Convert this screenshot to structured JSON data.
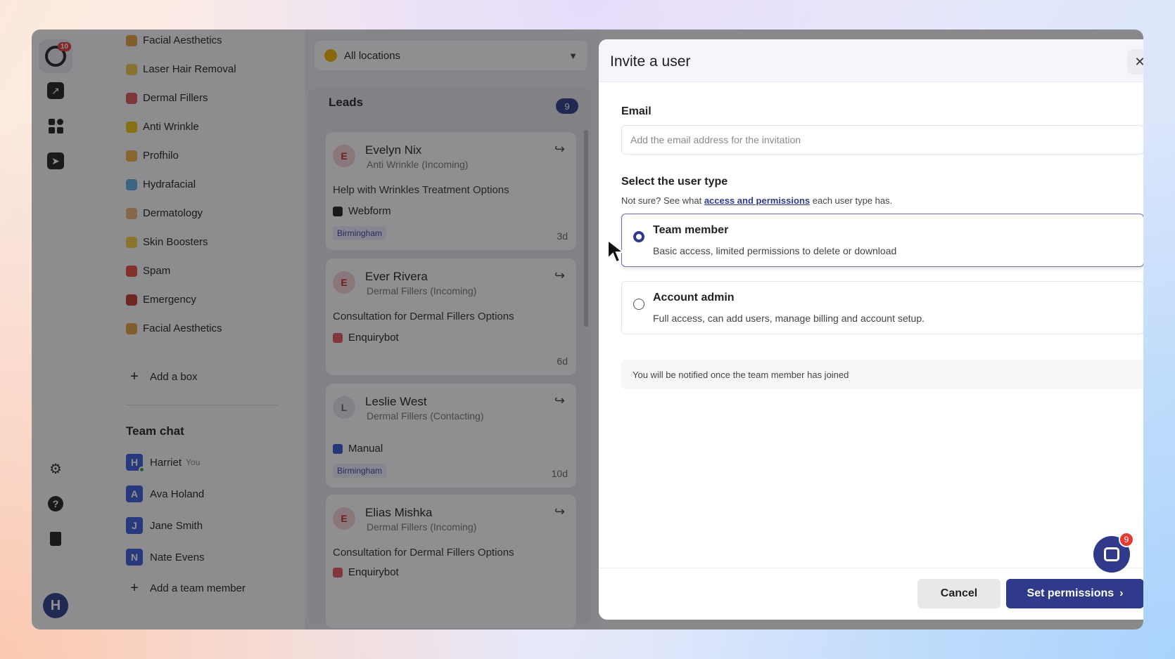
{
  "rail": {
    "logo_badge": "10",
    "user_initial": "H"
  },
  "sidebar": {
    "boxes": [
      {
        "label": "Facial Aesthetics",
        "color": "#e8a13a"
      },
      {
        "label": "Laser Hair Removal",
        "color": "#f2c94c"
      },
      {
        "label": "Dermal Fillers",
        "color": "#e0575b"
      },
      {
        "label": "Anti Wrinkle",
        "color": "#f1c40f"
      },
      {
        "label": "Profhilo",
        "color": "#f5b041"
      },
      {
        "label": "Hydrafacial",
        "color": "#5dade2"
      },
      {
        "label": "Dermatology",
        "color": "#f0b27a"
      },
      {
        "label": "Skin Boosters",
        "color": "#f4d03f"
      },
      {
        "label": "Spam",
        "color": "#e74c3c"
      },
      {
        "label": "Emergency",
        "color": "#c0392b"
      },
      {
        "label": "Facial Aesthetics",
        "color": "#e8a13a"
      }
    ],
    "add_box": "Add a box",
    "team_chat_title": "Team chat",
    "members": [
      {
        "initial": "H",
        "name": "Harriet",
        "tag": "You"
      },
      {
        "initial": "A",
        "name": "Ava Holand",
        "tag": ""
      },
      {
        "initial": "J",
        "name": "Jane Smith",
        "tag": ""
      },
      {
        "initial": "N",
        "name": "Nate Evens",
        "tag": ""
      }
    ],
    "add_member": "Add a team member"
  },
  "leads": {
    "location_filter": "All locations",
    "title": "Leads",
    "count": "9",
    "cards": [
      {
        "initial": "E",
        "name": "Evelyn Nix",
        "sub": "Anti Wrinkle (Incoming)",
        "title": "Help with Wrinkles Treatment Options",
        "source": "Webform",
        "location": "Birmingham",
        "age": "3d"
      },
      {
        "initial": "E",
        "name": "Ever Rivera",
        "sub": "Dermal Fillers (Incoming)",
        "title": "Consultation for Dermal Fillers Options",
        "source": "Enquirybot",
        "location": "",
        "age": "6d"
      },
      {
        "initial": "L",
        "name": "Leslie West",
        "sub": "Dermal Fillers (Contacting)",
        "title": "",
        "source": "Manual",
        "location": "Birmingham",
        "age": "10d"
      },
      {
        "initial": "E",
        "name": "Elias Mishka",
        "sub": "Dermal Fillers (Incoming)",
        "title": "Consultation for Dermal Fillers Options",
        "source": "Enquirybot",
        "location": "",
        "age": ""
      }
    ]
  },
  "modal": {
    "title": "Invite a user",
    "email_label": "Email",
    "email_placeholder": "Add the email address for the invitation",
    "user_type_label": "Select the user type",
    "hint_prefix": "Not sure? See what",
    "hint_link": "access and permissions",
    "hint_suffix": "each user type has.",
    "options": [
      {
        "title": "Team member",
        "desc": "Basic access, limited permissions to delete or download",
        "selected": true
      },
      {
        "title": "Account admin",
        "desc": "Full access, can add users, manage billing and account setup.",
        "selected": false
      }
    ],
    "notice": "You will be notified once the team member has joined",
    "cancel": "Cancel",
    "submit": "Set permissions"
  },
  "chat_widget": {
    "badge": "9"
  }
}
